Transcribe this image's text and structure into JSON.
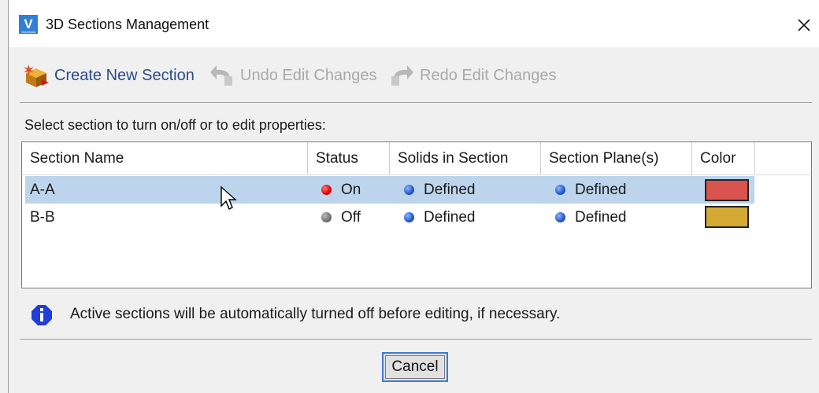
{
  "window": {
    "title": "3D Sections Management",
    "app_icon": "vectorworks-logo-icon",
    "app_icon_letter": "V",
    "app_icon_caption": "VectorWorks"
  },
  "toolbar": {
    "create_label": "Create New Section",
    "undo_label": "Undo Edit Changes",
    "redo_label": "Redo Edit Changes"
  },
  "prompt": "Select section to turn on/off or to edit properties:",
  "table": {
    "headers": [
      "Section Name",
      "Status",
      "Solids in Section",
      "Section Plane(s)",
      "Color"
    ],
    "rows": [
      {
        "name": "A-A",
        "status": "On",
        "status_color": "#e00000",
        "solids": "Defined",
        "planes": "Defined",
        "color": "#d9534f",
        "selected": true
      },
      {
        "name": "B-B",
        "status": "Off",
        "status_color": "#707070",
        "solids": "Defined",
        "planes": "Defined",
        "color": "#d4aa35",
        "selected": false
      }
    ]
  },
  "info_text": "Active sections will be automatically turned off before editing, if necessary.",
  "cancel_label": "Cancel",
  "colors": {
    "selection": "#bcd4ec",
    "link_blue": "#2b4a8a",
    "disabled": "#a9a9a9",
    "info_blue": "#1f3fd6"
  }
}
